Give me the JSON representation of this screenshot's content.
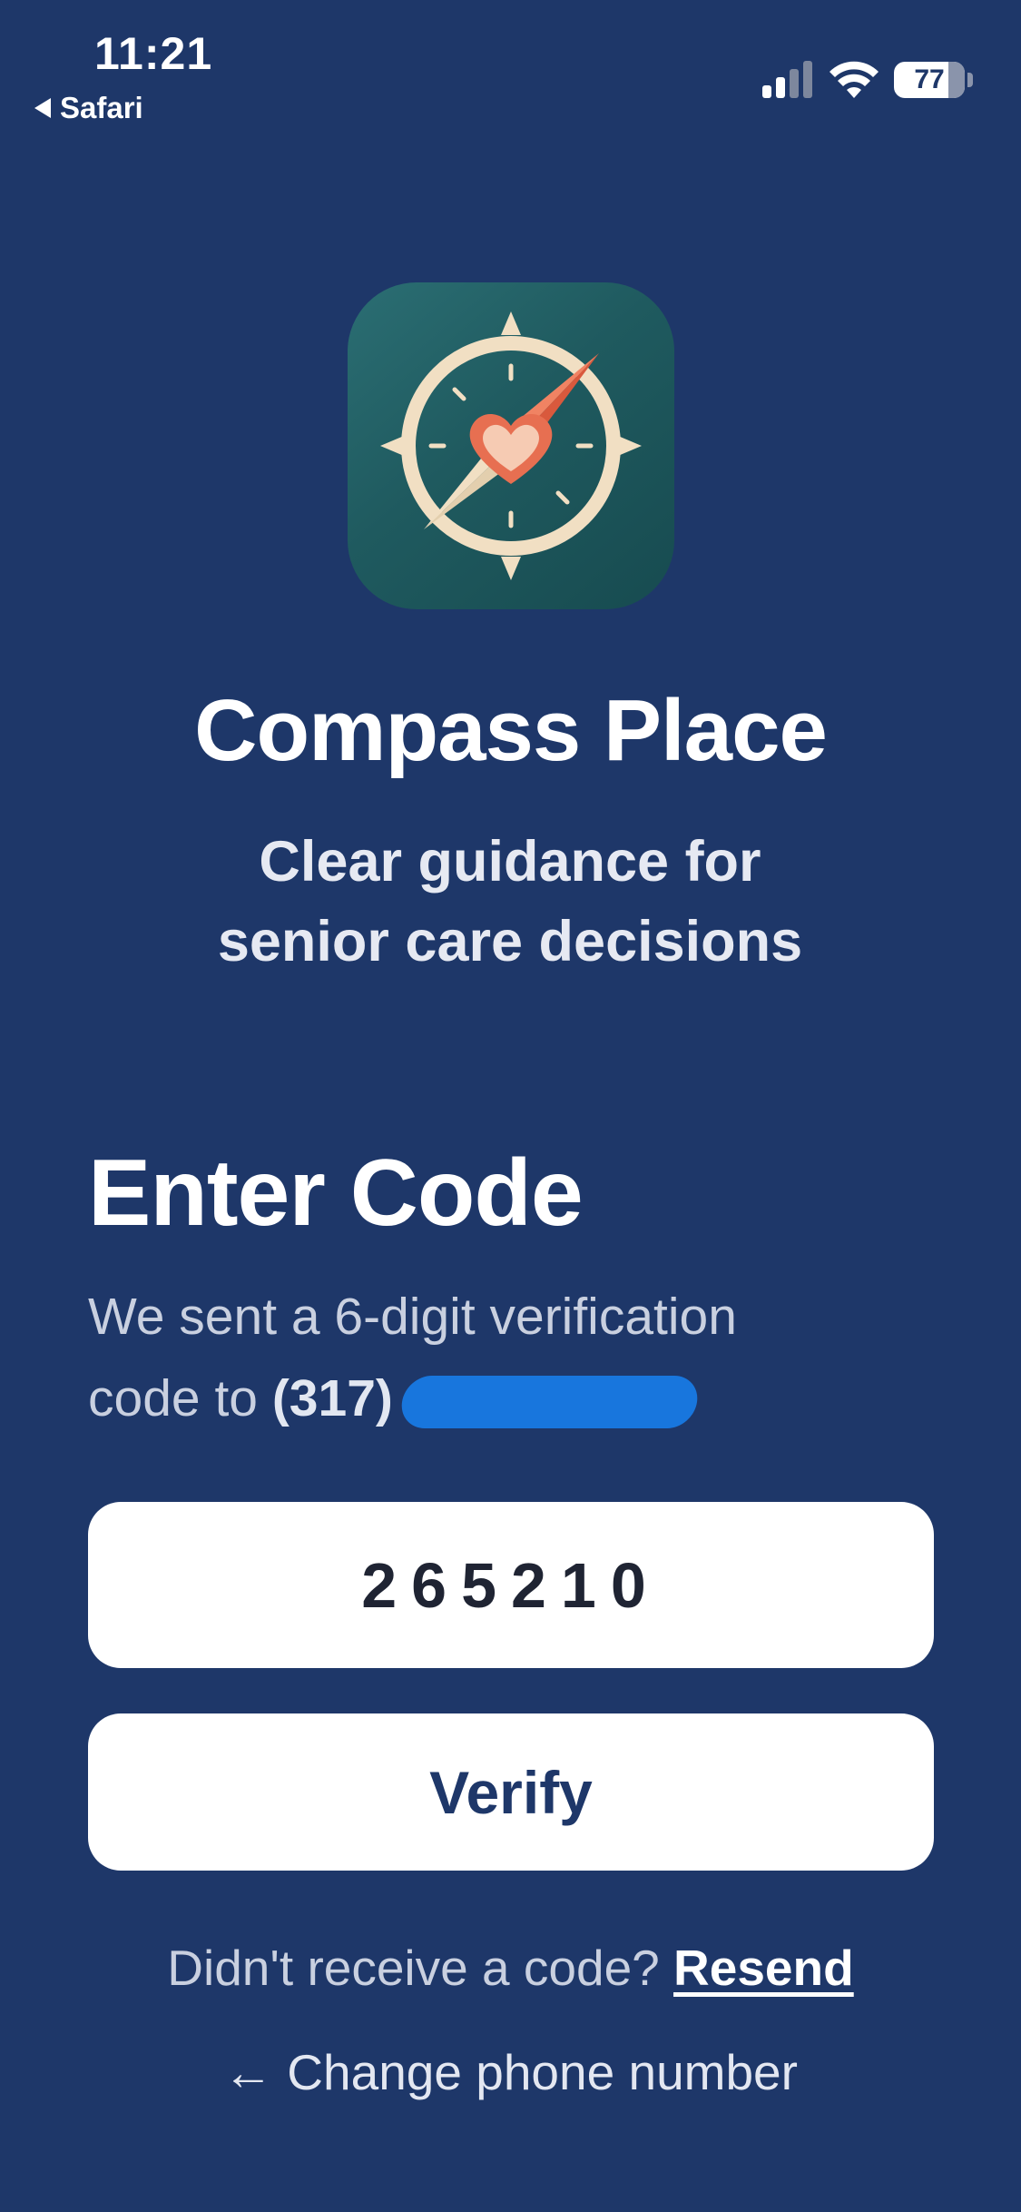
{
  "status_bar": {
    "time": "11:21",
    "back_label": "Safari",
    "battery_level": "77",
    "signal_bars": 2
  },
  "app": {
    "title": "Compass Place",
    "tagline_line1": "Clear guidance for",
    "tagline_line2": "senior care decisions",
    "logo_icon": "compass-heart-icon",
    "logo_colors": {
      "background": "#1f5a5f",
      "ring": "#f1dfc3",
      "needle": "#e76f51",
      "heart": "#f6cbb3"
    }
  },
  "verification": {
    "heading": "Enter Code",
    "instruction_line1": "We sent a 6-digit verification",
    "instruction_line2_prefix": "code to ",
    "phone_prefix": "(317)",
    "code_value": "265210",
    "verify_label": "Verify",
    "resend_prompt": "Didn't receive a code?",
    "resend_label": "Resend",
    "change_number_label": "← Change phone number"
  },
  "colors": {
    "background": "#1e3769",
    "button_background": "#ffffff",
    "button_text": "#1e3769",
    "redaction": "#1876dd"
  }
}
